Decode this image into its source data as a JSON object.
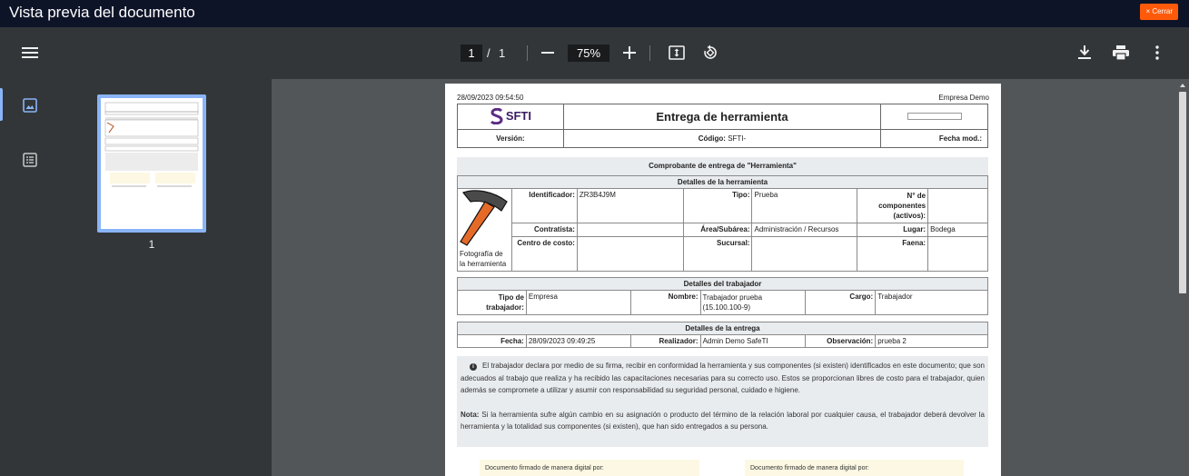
{
  "window": {
    "title": "Vista previa del documento",
    "close_label": "× Cerrar"
  },
  "toolbar": {
    "current_page": "1",
    "page_separator": "/",
    "total_pages": "1",
    "zoom": "75%"
  },
  "sidebar": {
    "thumbnail_page": "1"
  },
  "document": {
    "printed_at": "28/09/2023 09:54:50",
    "company": "Empresa Demo",
    "logo_text": "SFTI",
    "title": "Entrega de herramienta",
    "version_label": "Versión:",
    "code_label": "Código:",
    "code_value": "SFTI-",
    "date_mod_label": "Fecha mod.:",
    "receipt_title": "Comprobante de entrega de \"Herramienta\"",
    "tool_section": {
      "title": "Detalles de la herramienta",
      "photo_caption": "Fotografía de la herramienta",
      "id_label": "Identificador:",
      "id_value": "ZR3B4J9M",
      "type_label": "Tipo:",
      "type_value": "Prueba",
      "components_label": "N° de componentes (activos):",
      "components_value": "",
      "contractor_label": "Contratista:",
      "contractor_value": "",
      "area_label": "Área/Subárea:",
      "area_value": "Administración / Recursos",
      "place_label": "Lugar:",
      "place_value": "Bodega",
      "cost_center_label": "Centro de costo:",
      "cost_center_value": "",
      "branch_label": "Sucursal:",
      "branch_value": "",
      "task_label": "Faena:",
      "task_value": ""
    },
    "worker_section": {
      "title": "Detalles del trabajador",
      "worker_type_label": "Tipo de trabajador:",
      "worker_type_value": "Empresa",
      "name_label": "Nombre:",
      "name_value": "Trabajador prueba (15.100.100-9)",
      "position_label": "Cargo:",
      "position_value": "Trabajador"
    },
    "delivery_section": {
      "title": "Detalles de la entrega",
      "date_label": "Fecha:",
      "date_value": "28/09/2023 09:49:25",
      "performer_label": "Realizador:",
      "performer_value": "Admin Demo SafeTI",
      "observation_label": "Observación:",
      "observation_value": "prueba 2"
    },
    "declaration": "El trabajador declara por medio de su firma, recibir en conformidad la herramienta y sus componentes (si existen) identificados en este documento; que son adecuados al trabajo que realiza y ha recibido las capacitaciones necesarias para su correcto uso. Estos se proporcionan libres de costo para el trabajador, quien además se compromete a utilizar y asumir con responsabilidad su seguridad personal, cuidado e higiene.",
    "note_label": "Nota:",
    "note_text": "Si la herramienta sufre algún cambio en su asignación o producto del término de la relación laboral por cualquier causa, el trabajador deberá devolver la herramienta y la totalidad sus componentes (si existen), que han sido entregados a su persona.",
    "signature_left": "Documento firmado de manera digital por:",
    "signature_right": "Documento firmado de manera digital por:"
  },
  "icons": {
    "menu": "menu-icon",
    "zoom_out": "minus-icon",
    "zoom_in": "plus-icon",
    "fit": "fit-page-icon",
    "rotate": "rotate-icon",
    "download": "download-icon",
    "print": "print-icon",
    "more": "more-vert-icon",
    "thumbnails": "thumbnails-icon",
    "outline": "outline-icon"
  },
  "colors": {
    "titlebar": "#0e1428",
    "toolbar": "#323639",
    "viewer_bg": "#525659",
    "close_button": "#ff5a0a",
    "accent": "#8ab4f8",
    "logo_purple": "#5b2c83"
  }
}
